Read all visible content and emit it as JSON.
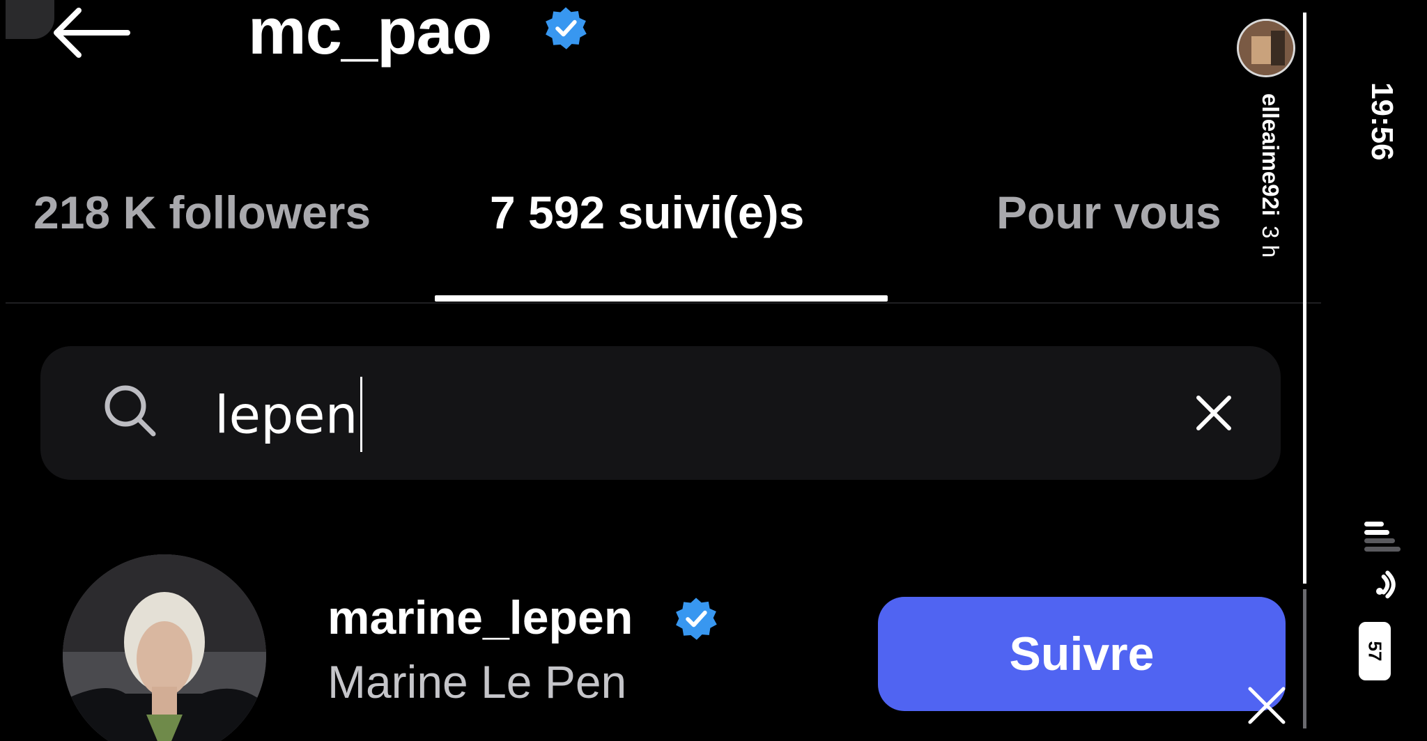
{
  "header": {
    "title": "mc_pao",
    "verified_icon": "verified-badge-icon",
    "back_icon": "arrow-left-icon"
  },
  "tabs": [
    {
      "label": "218 K followers",
      "active": false
    },
    {
      "label": "7 592 suivi(e)s",
      "active": true
    },
    {
      "label": "Pour vous",
      "active": false
    }
  ],
  "search": {
    "value": "lepen",
    "icon": "search-icon",
    "clear_icon": "close-icon"
  },
  "results": [
    {
      "handle": "marine_lepen",
      "name": "Marine Le Pen",
      "verified": true,
      "button_label": "Suivre"
    }
  ],
  "story_overlay": {
    "username": "elleaime92i",
    "time_ago": "3 h"
  },
  "status_bar": {
    "time": "19:56",
    "battery": "57"
  },
  "colors": {
    "accent_button": "#5064f2",
    "verified_blue": "#3897f0",
    "background": "#000000"
  }
}
